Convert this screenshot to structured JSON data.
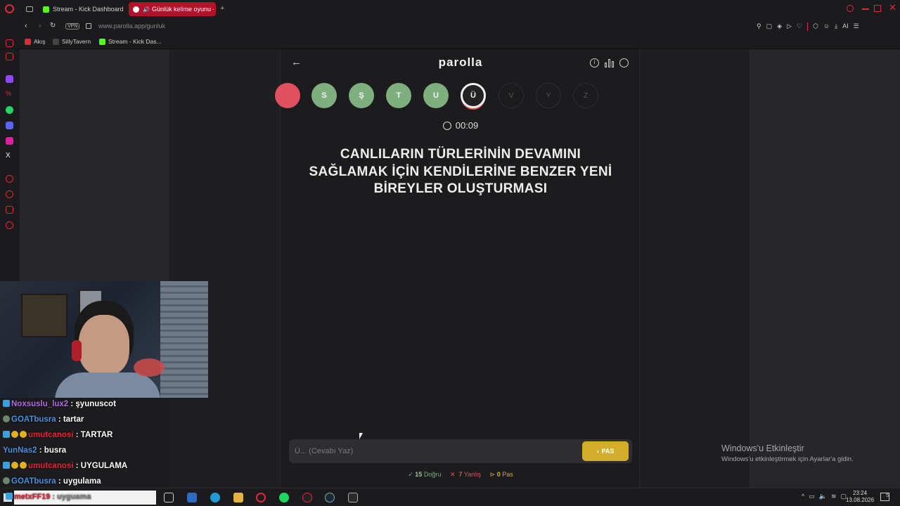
{
  "browser": {
    "tabs": [
      {
        "label": "Stream - Kick Dashboard"
      },
      {
        "label": "Günlük kelime oyunu - p"
      }
    ],
    "url_domain": "www.parolla.app",
    "url_path": "/gunluk",
    "vpn_label": "VPN",
    "bookmarks": [
      {
        "label": "Akış"
      },
      {
        "label": "SillyTavern"
      },
      {
        "label": "Stream - Kick Das..."
      }
    ],
    "ai_label": "AI"
  },
  "app": {
    "title": "parolla",
    "letters": [
      {
        "char": "",
        "state": "wrong"
      },
      {
        "char": "S",
        "state": "done"
      },
      {
        "char": "Ş",
        "state": "done"
      },
      {
        "char": "T",
        "state": "done"
      },
      {
        "char": "U",
        "state": "done"
      },
      {
        "char": "Ü",
        "state": "current"
      },
      {
        "char": "V",
        "state": "pending"
      },
      {
        "char": "Y",
        "state": "pending"
      },
      {
        "char": "Z",
        "state": "pending"
      }
    ],
    "timer": "00:09",
    "question": "CANLILARIN TÜRLERİNİN DEVAMINI SAĞLAMAK İÇİN KENDİLERİNE BENZER YENİ BİREYLER OLUŞTURMASI",
    "answer_placeholder": "Ü... (Cevabı Yaz)",
    "pas_button": "PAS",
    "stats": {
      "correct_count": "15",
      "correct_label": "Doğru",
      "wrong_count": "7",
      "wrong_label": "Yanlış",
      "pass_count": "0",
      "pass_label": "Pas"
    },
    "colors": {
      "correct": "#7fae7f",
      "wrong": "#e05060",
      "pas": "#d4ad2b"
    }
  },
  "chat": [
    {
      "user": "Noxsuslu_lux2",
      "message": ": şyunuscot",
      "color": "#b06be0"
    },
    {
      "user": "GOATbusra",
      "message": ": tartar",
      "color": "#4a8fe0"
    },
    {
      "user": "umutcanosi",
      "message": ": TARTAR",
      "color": "#e0283a"
    },
    {
      "user": "YunNas2",
      "message": ": busra",
      "color": "#4a8fe0"
    },
    {
      "user": "umutcanosi",
      "message": ": UYGULAMA",
      "color": "#e0283a"
    },
    {
      "user": "GOATbusra",
      "message": ": uygulama",
      "color": "#4a8fe0"
    },
    {
      "user": "metxFF19",
      "message": ": uyguama",
      "color": "#e0283a"
    }
  ],
  "windows": {
    "activate_title": "Windows'u Etkinleştir",
    "activate_sub": "Windows'u etkinleştirmek için Ayarlar'a gidin.",
    "clock_time": "23:24",
    "clock_date": "13.08.2026",
    "notif_count": "5"
  }
}
